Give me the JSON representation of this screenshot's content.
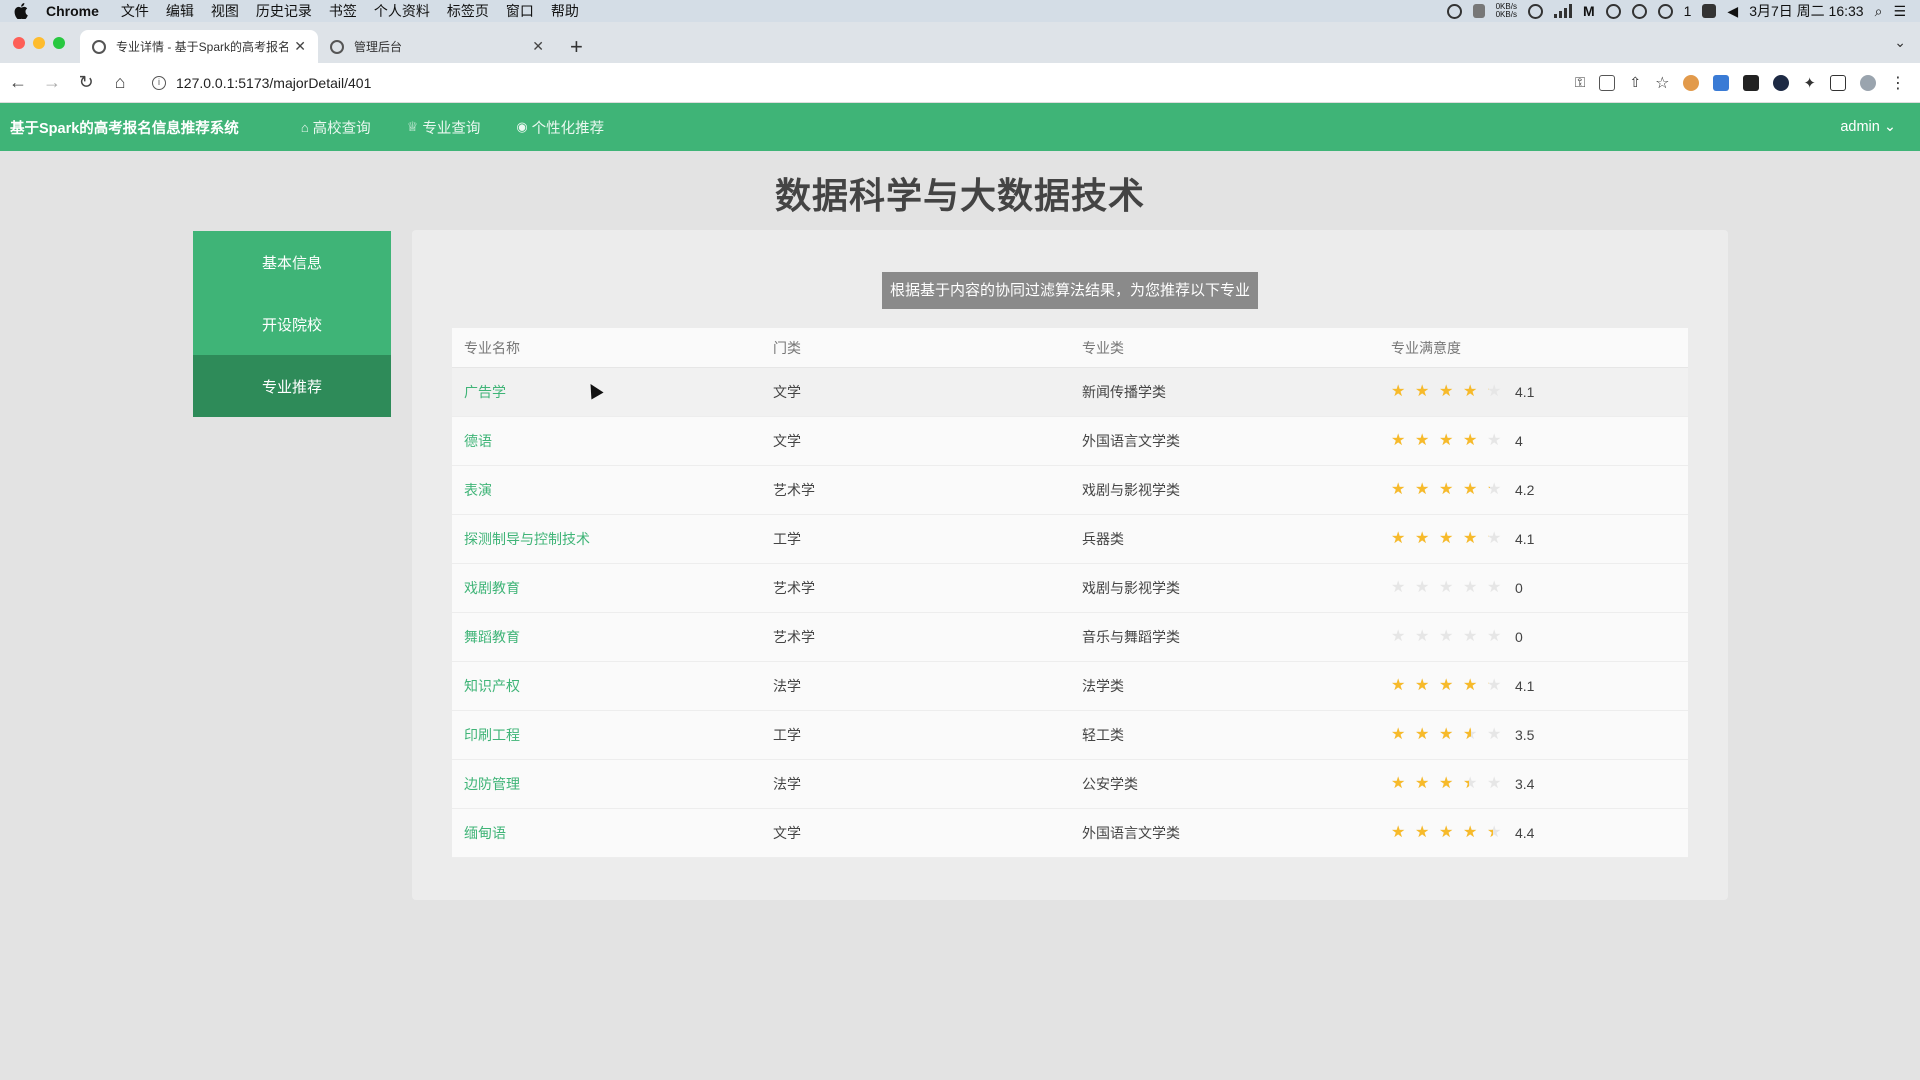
{
  "menubar": {
    "app_name": "Chrome",
    "items": [
      "文件",
      "编辑",
      "视图",
      "历史记录",
      "书签",
      "个人资料",
      "标签页",
      "窗口",
      "帮助"
    ],
    "net_up": "0KB/s",
    "net_down": "0KB/s",
    "badge_count": "1",
    "datetime": "3月7日 周二 16:33"
  },
  "browser": {
    "tabs": [
      {
        "title": "专业详情 - 基于Spark的高考报名"
      },
      {
        "title": "管理后台"
      }
    ],
    "url": "127.0.0.1:5173/majorDetail/401"
  },
  "navbar": {
    "brand": "基于Spark的高考报名信息推荐系统",
    "links": [
      {
        "label": "高校查询",
        "icon": "university-icon"
      },
      {
        "label": "专业查询",
        "icon": "trophy-icon"
      },
      {
        "label": "个性化推荐",
        "icon": "target-icon"
      }
    ],
    "user": "admin"
  },
  "page": {
    "title": "数据科学与大数据技术"
  },
  "sidemenu": {
    "items": [
      "基本信息",
      "开设院校",
      "专业推荐"
    ],
    "active": "专业推荐"
  },
  "notice": "根据基于内容的协同过滤算法结果，为您推荐以下专业",
  "table": {
    "headers": [
      "专业名称",
      "门类",
      "专业类",
      "专业满意度"
    ],
    "rows": [
      {
        "name": "广告学",
        "category": "文学",
        "class": "新闻传播学类",
        "rating": 4.1,
        "rating_text": "4.1"
      },
      {
        "name": "德语",
        "category": "文学",
        "class": "外国语言文学类",
        "rating": 4,
        "rating_text": "4"
      },
      {
        "name": "表演",
        "category": "艺术学",
        "class": "戏剧与影视学类",
        "rating": 4.2,
        "rating_text": "4.2"
      },
      {
        "name": "探测制导与控制技术",
        "category": "工学",
        "class": "兵器类",
        "rating": 4.1,
        "rating_text": "4.1"
      },
      {
        "name": "戏剧教育",
        "category": "艺术学",
        "class": "戏剧与影视学类",
        "rating": 0,
        "rating_text": "0"
      },
      {
        "name": "舞蹈教育",
        "category": "艺术学",
        "class": "音乐与舞蹈学类",
        "rating": 0,
        "rating_text": "0"
      },
      {
        "name": "知识产权",
        "category": "法学",
        "class": "法学类",
        "rating": 4.1,
        "rating_text": "4.1"
      },
      {
        "name": "印刷工程",
        "category": "工学",
        "class": "轻工类",
        "rating": 3.5,
        "rating_text": "3.5"
      },
      {
        "name": "边防管理",
        "category": "法学",
        "class": "公安学类",
        "rating": 3.4,
        "rating_text": "3.4"
      },
      {
        "name": "缅甸语",
        "category": "文学",
        "class": "外国语言文学类",
        "rating": 4.4,
        "rating_text": "4.4"
      }
    ]
  },
  "colors": {
    "brand_green": "#3fb477",
    "active_green": "#2e8b59",
    "star": "#f7ba2a"
  }
}
